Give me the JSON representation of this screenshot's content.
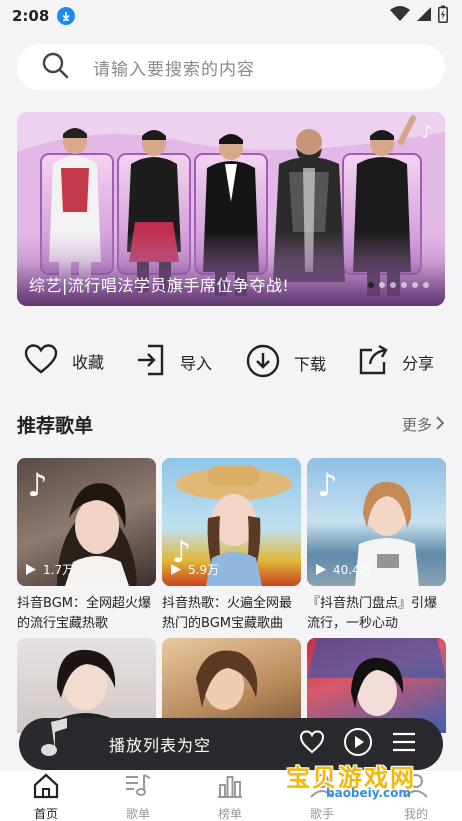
{
  "status": {
    "time": "2:08"
  },
  "search": {
    "placeholder": "请输入要搜索的内容"
  },
  "banner": {
    "caption": "综艺|流行唱法学员旗手席位争夺战!",
    "dots_total": 6,
    "active_dot": 1
  },
  "actions": [
    {
      "label": "收藏",
      "icon": "heart-icon"
    },
    {
      "label": "导入",
      "icon": "import-icon"
    },
    {
      "label": "下载",
      "icon": "download-icon"
    },
    {
      "label": "分享",
      "icon": "share-icon"
    }
  ],
  "section": {
    "title": "推荐歌单",
    "more": "更多"
  },
  "playlists": [
    {
      "count": "1.7万",
      "title": "抖音BGM：全网超火爆的流行宝藏热歌"
    },
    {
      "count": "5.9万",
      "title": "抖音热歌：火遍全网最热门的BGM宝藏歌曲"
    },
    {
      "count": "40.4万",
      "title": "『抖音热门盘点』引爆流行，一秒心动"
    }
  ],
  "player": {
    "status_text": "播放列表为空"
  },
  "tabs": [
    {
      "label": "首页",
      "icon": "home-icon",
      "active": true
    },
    {
      "label": "歌单",
      "icon": "music-list-icon",
      "active": false
    },
    {
      "label": "榜单",
      "icon": "chart-icon",
      "active": false
    },
    {
      "label": "歌手",
      "icon": "singer-icon",
      "active": false
    },
    {
      "label": "我的",
      "icon": "user-icon",
      "active": false
    }
  ],
  "watermark": {
    "text": "宝贝游戏网",
    "url": "baobeiy.com"
  },
  "colors": {
    "accent_download": "#1a8cf0",
    "player_bg": "#2a2a2e",
    "watermark": "#f2b90a"
  }
}
